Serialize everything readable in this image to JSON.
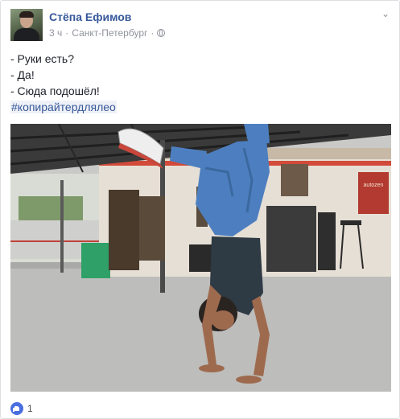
{
  "author": {
    "name": "Стёпа Ефимов"
  },
  "meta": {
    "time": "3 ч",
    "separator": "·",
    "location": "Санкт-Петербург"
  },
  "post": {
    "lines": [
      "- Руки есть?",
      "- Да!",
      "- Сюда подошёл!"
    ],
    "hashtag": "#копирайтердлялео"
  },
  "photo": {
    "sign_text": "autozen"
  },
  "reactions": {
    "count": "1",
    "icon": "like-icon"
  },
  "icons": {
    "menu": "chevron-down-icon",
    "audience": "globe-icon"
  },
  "colors": {
    "link": "#365899",
    "secondary": "#90949c",
    "like": "#4a6ee0"
  }
}
